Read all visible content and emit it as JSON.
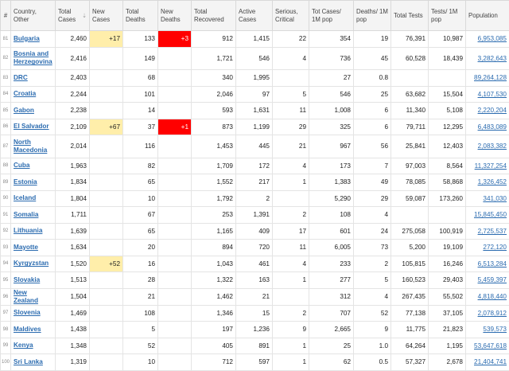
{
  "headers": {
    "idx": "#",
    "country": "Country, Other",
    "total_cases": "Total Cases",
    "new_cases": "New Cases",
    "total_deaths": "Total Deaths",
    "new_deaths": "New Deaths",
    "total_recovered": "Total Recovered",
    "active_cases": "Active Cases",
    "serious": "Serious, Critical",
    "cases_per_1m": "Tot Cases/ 1M pop",
    "deaths_per_1m": "Deaths/ 1M pop",
    "total_tests": "Total Tests",
    "tests_per_1m": "Tests/ 1M pop",
    "population": "Population"
  },
  "highlight_colors": {
    "new_cases": "#ffeeaa",
    "new_deaths": "#ff0000"
  },
  "rows": [
    {
      "idx": "81",
      "country": "Bulgaria",
      "total_cases": "2,460",
      "new_cases": "+17",
      "total_deaths": "133",
      "new_deaths": "+3",
      "total_recovered": "912",
      "active_cases": "1,415",
      "serious": "22",
      "cases_per_1m": "354",
      "deaths_per_1m": "19",
      "total_tests": "76,391",
      "tests_per_1m": "10,987",
      "population": "6,953,085",
      "tall": false
    },
    {
      "idx": "82",
      "country": "Bosnia and Herzegovina",
      "total_cases": "2,416",
      "new_cases": "",
      "total_deaths": "149",
      "new_deaths": "",
      "total_recovered": "1,721",
      "active_cases": "546",
      "serious": "4",
      "cases_per_1m": "736",
      "deaths_per_1m": "45",
      "total_tests": "60,528",
      "tests_per_1m": "18,439",
      "population": "3,282,643",
      "tall": true
    },
    {
      "idx": "83",
      "country": "DRC",
      "total_cases": "2,403",
      "new_cases": "",
      "total_deaths": "68",
      "new_deaths": "",
      "total_recovered": "340",
      "active_cases": "1,995",
      "serious": "",
      "cases_per_1m": "27",
      "deaths_per_1m": "0.8",
      "total_tests": "",
      "tests_per_1m": "",
      "population": "89,264,128",
      "tall": false
    },
    {
      "idx": "84",
      "country": "Croatia",
      "total_cases": "2,244",
      "new_cases": "",
      "total_deaths": "101",
      "new_deaths": "",
      "total_recovered": "2,046",
      "active_cases": "97",
      "serious": "5",
      "cases_per_1m": "546",
      "deaths_per_1m": "25",
      "total_tests": "63,682",
      "tests_per_1m": "15,504",
      "population": "4,107,530",
      "tall": false
    },
    {
      "idx": "85",
      "country": "Gabon",
      "total_cases": "2,238",
      "new_cases": "",
      "total_deaths": "14",
      "new_deaths": "",
      "total_recovered": "593",
      "active_cases": "1,631",
      "serious": "11",
      "cases_per_1m": "1,008",
      "deaths_per_1m": "6",
      "total_tests": "11,340",
      "tests_per_1m": "5,108",
      "population": "2,220,204",
      "tall": false
    },
    {
      "idx": "86",
      "country": "El Salvador",
      "total_cases": "2,109",
      "new_cases": "+67",
      "total_deaths": "37",
      "new_deaths": "+1",
      "total_recovered": "873",
      "active_cases": "1,199",
      "serious": "29",
      "cases_per_1m": "325",
      "deaths_per_1m": "6",
      "total_tests": "79,711",
      "tests_per_1m": "12,295",
      "population": "6,483,089",
      "tall": false
    },
    {
      "idx": "87",
      "country": "North Macedonia",
      "total_cases": "2,014",
      "new_cases": "",
      "total_deaths": "116",
      "new_deaths": "",
      "total_recovered": "1,453",
      "active_cases": "445",
      "serious": "21",
      "cases_per_1m": "967",
      "deaths_per_1m": "56",
      "total_tests": "25,841",
      "tests_per_1m": "12,403",
      "population": "2,083,382",
      "tall": true
    },
    {
      "idx": "88",
      "country": "Cuba",
      "total_cases": "1,963",
      "new_cases": "",
      "total_deaths": "82",
      "new_deaths": "",
      "total_recovered": "1,709",
      "active_cases": "172",
      "serious": "4",
      "cases_per_1m": "173",
      "deaths_per_1m": "7",
      "total_tests": "97,003",
      "tests_per_1m": "8,564",
      "population": "11,327,254",
      "tall": false
    },
    {
      "idx": "89",
      "country": "Estonia",
      "total_cases": "1,834",
      "new_cases": "",
      "total_deaths": "65",
      "new_deaths": "",
      "total_recovered": "1,552",
      "active_cases": "217",
      "serious": "1",
      "cases_per_1m": "1,383",
      "deaths_per_1m": "49",
      "total_tests": "78,085",
      "tests_per_1m": "58,868",
      "population": "1,326,452",
      "tall": false
    },
    {
      "idx": "90",
      "country": "Iceland",
      "total_cases": "1,804",
      "new_cases": "",
      "total_deaths": "10",
      "new_deaths": "",
      "total_recovered": "1,792",
      "active_cases": "2",
      "serious": "",
      "cases_per_1m": "5,290",
      "deaths_per_1m": "29",
      "total_tests": "59,087",
      "tests_per_1m": "173,260",
      "population": "341,030",
      "tall": false
    },
    {
      "idx": "91",
      "country": "Somalia",
      "total_cases": "1,711",
      "new_cases": "",
      "total_deaths": "67",
      "new_deaths": "",
      "total_recovered": "253",
      "active_cases": "1,391",
      "serious": "2",
      "cases_per_1m": "108",
      "deaths_per_1m": "4",
      "total_tests": "",
      "tests_per_1m": "",
      "population": "15,845,450",
      "tall": false
    },
    {
      "idx": "92",
      "country": "Lithuania",
      "total_cases": "1,639",
      "new_cases": "",
      "total_deaths": "65",
      "new_deaths": "",
      "total_recovered": "1,165",
      "active_cases": "409",
      "serious": "17",
      "cases_per_1m": "601",
      "deaths_per_1m": "24",
      "total_tests": "275,058",
      "tests_per_1m": "100,919",
      "population": "2,725,537",
      "tall": false
    },
    {
      "idx": "93",
      "country": "Mayotte",
      "total_cases": "1,634",
      "new_cases": "",
      "total_deaths": "20",
      "new_deaths": "",
      "total_recovered": "894",
      "active_cases": "720",
      "serious": "11",
      "cases_per_1m": "6,005",
      "deaths_per_1m": "73",
      "total_tests": "5,200",
      "tests_per_1m": "19,109",
      "population": "272,120",
      "tall": false
    },
    {
      "idx": "94",
      "country": "Kyrgyzstan",
      "total_cases": "1,520",
      "new_cases": "+52",
      "total_deaths": "16",
      "new_deaths": "",
      "total_recovered": "1,043",
      "active_cases": "461",
      "serious": "4",
      "cases_per_1m": "233",
      "deaths_per_1m": "2",
      "total_tests": "105,815",
      "tests_per_1m": "16,246",
      "population": "6,513,284",
      "tall": false
    },
    {
      "idx": "95",
      "country": "Slovakia",
      "total_cases": "1,513",
      "new_cases": "",
      "total_deaths": "28",
      "new_deaths": "",
      "total_recovered": "1,322",
      "active_cases": "163",
      "serious": "1",
      "cases_per_1m": "277",
      "deaths_per_1m": "5",
      "total_tests": "160,523",
      "tests_per_1m": "29,403",
      "population": "5,459,397",
      "tall": false
    },
    {
      "idx": "96",
      "country": "New Zealand",
      "total_cases": "1,504",
      "new_cases": "",
      "total_deaths": "21",
      "new_deaths": "",
      "total_recovered": "1,462",
      "active_cases": "21",
      "serious": "",
      "cases_per_1m": "312",
      "deaths_per_1m": "4",
      "total_tests": "267,435",
      "tests_per_1m": "55,502",
      "population": "4,818,440",
      "tall": false
    },
    {
      "idx": "97",
      "country": "Slovenia",
      "total_cases": "1,469",
      "new_cases": "",
      "total_deaths": "108",
      "new_deaths": "",
      "total_recovered": "1,346",
      "active_cases": "15",
      "serious": "2",
      "cases_per_1m": "707",
      "deaths_per_1m": "52",
      "total_tests": "77,138",
      "tests_per_1m": "37,105",
      "population": "2,078,912",
      "tall": false
    },
    {
      "idx": "98",
      "country": "Maldives",
      "total_cases": "1,438",
      "new_cases": "",
      "total_deaths": "5",
      "new_deaths": "",
      "total_recovered": "197",
      "active_cases": "1,236",
      "serious": "9",
      "cases_per_1m": "2,665",
      "deaths_per_1m": "9",
      "total_tests": "11,775",
      "tests_per_1m": "21,823",
      "population": "539,573",
      "tall": false
    },
    {
      "idx": "99",
      "country": "Kenya",
      "total_cases": "1,348",
      "new_cases": "",
      "total_deaths": "52",
      "new_deaths": "",
      "total_recovered": "405",
      "active_cases": "891",
      "serious": "1",
      "cases_per_1m": "25",
      "deaths_per_1m": "1.0",
      "total_tests": "64,264",
      "tests_per_1m": "1,195",
      "population": "53,647,618",
      "tall": false
    },
    {
      "idx": "100",
      "country": "Sri Lanka",
      "total_cases": "1,319",
      "new_cases": "",
      "total_deaths": "10",
      "new_deaths": "",
      "total_recovered": "712",
      "active_cases": "597",
      "serious": "1",
      "cases_per_1m": "62",
      "deaths_per_1m": "0.5",
      "total_tests": "57,327",
      "tests_per_1m": "2,678",
      "population": "21,404,741",
      "tall": false
    }
  ]
}
